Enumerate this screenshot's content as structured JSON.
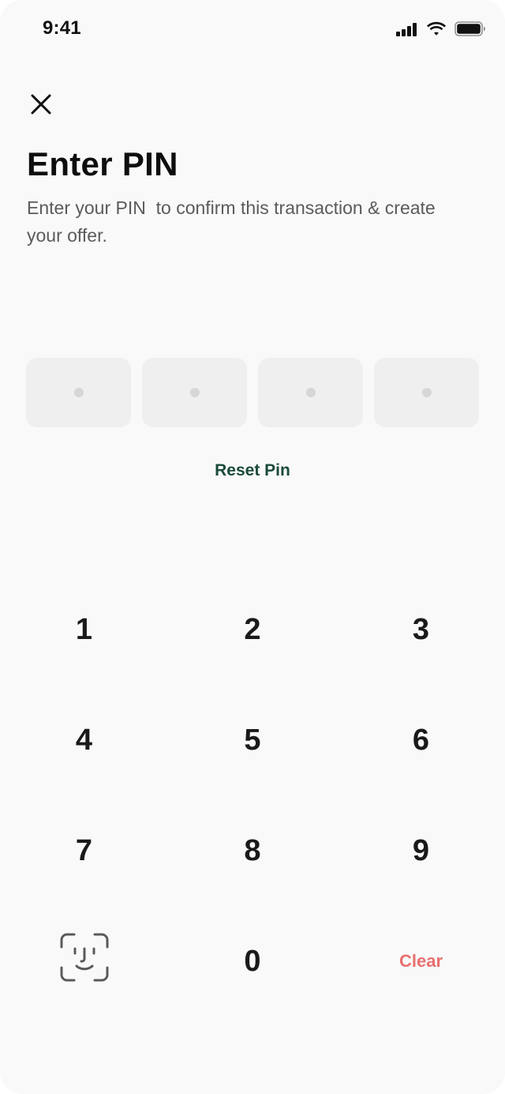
{
  "status_bar": {
    "time": "9:41"
  },
  "header": {
    "title": "Enter PIN",
    "subtitle": "Enter your PIN  to confirm this transaction & create your offer."
  },
  "pin": {
    "length": 4,
    "entered": 0
  },
  "reset_label": "Reset Pin",
  "keypad": {
    "key_1": "1",
    "key_2": "2",
    "key_3": "3",
    "key_4": "4",
    "key_5": "5",
    "key_6": "6",
    "key_7": "7",
    "key_8": "8",
    "key_9": "9",
    "key_0": "0",
    "clear_label": "Clear",
    "face_id_icon": "face-id-icon"
  },
  "icons": {
    "close": "close-icon",
    "signal": "cellular-signal-icon",
    "wifi": "wifi-icon",
    "battery": "battery-icon"
  },
  "colors": {
    "background": "#f9f9f9",
    "pin_box": "#efefef",
    "pin_dot": "#d6d6d6",
    "accent_green": "#1b4a3a",
    "clear_red": "#e86f6f",
    "text_primary": "#0e0e0e",
    "text_secondary": "#5b5b5b"
  }
}
